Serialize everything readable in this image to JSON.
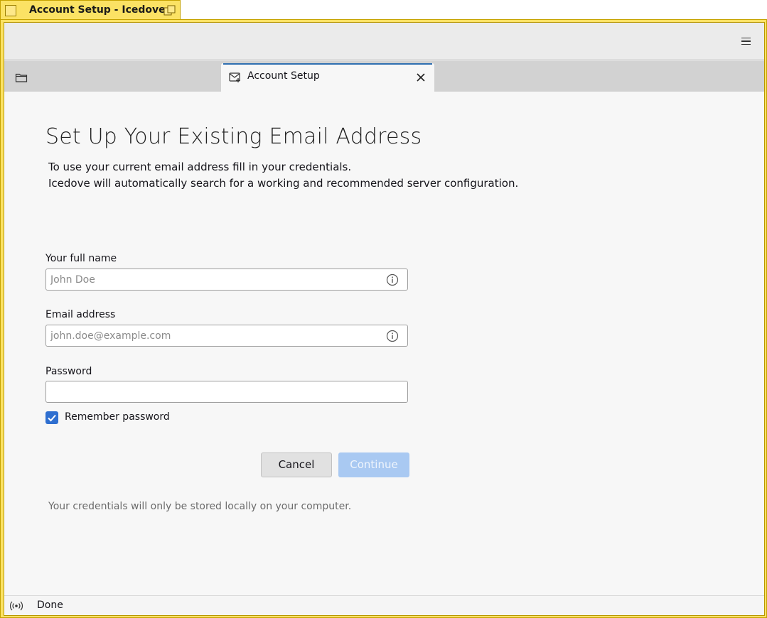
{
  "window": {
    "title": "Account Setup - Icedove",
    "frame_color": "#fbe264"
  },
  "toolbar": {
    "menu_icon": "hamburger-menu-icon"
  },
  "tabs": [
    {
      "label": "Account Setup",
      "icon": "mail-setup-icon",
      "active": true
    }
  ],
  "page": {
    "title": "Set Up Your Existing Email Address",
    "intro_line1": "To use your current email address fill in your credentials.",
    "intro_line2": "Icedove will automatically search for a working and recommended server configuration."
  },
  "form": {
    "full_name": {
      "label": "Your full name",
      "value": "",
      "placeholder": "John Doe"
    },
    "email": {
      "label": "Email address",
      "value": "",
      "placeholder": "john.doe@example.com"
    },
    "password": {
      "label": "Password",
      "value": ""
    },
    "remember": {
      "label": "Remember password",
      "checked": true
    }
  },
  "buttons": {
    "cancel": "Cancel",
    "continue": "Continue"
  },
  "footnote": "Your credentials will only be stored locally on your computer.",
  "status": {
    "text": "Done",
    "icon": "connection-status-icon"
  },
  "colors": {
    "accent": "#2f6fd0",
    "continue_disabled": "#a9c9f2"
  }
}
